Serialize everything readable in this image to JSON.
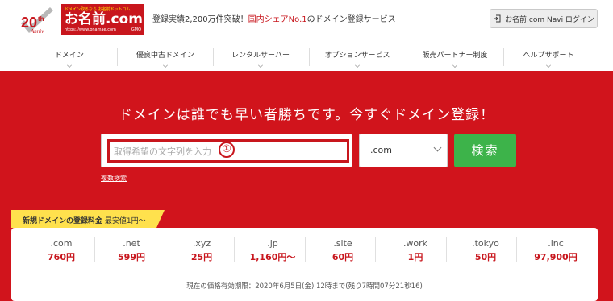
{
  "header": {
    "anniversary_number": "20",
    "anniversary_suffix": "th",
    "anniversary_text": "Anniv.",
    "logo_tagline": "ドメイン取るなら お名前ドットコム",
    "logo_text": "お名前.com",
    "logo_url": "https://www.onamae.com",
    "logo_brand": "GMO",
    "tagline_prefix": "登録実績2,200万件突破！",
    "tagline_highlight": "国内シェアNo.1",
    "tagline_suffix": "のドメイン登録サービス",
    "login_label": "お名前.com Navi ログイン",
    "colors": {
      "brand_red": "#c8161d"
    }
  },
  "nav": {
    "items": [
      {
        "label": "ドメイン"
      },
      {
        "label": "優良中古ドメイン"
      },
      {
        "label": "レンタルサーバー"
      },
      {
        "label": "オプションサービス"
      },
      {
        "label": "販売パートナー制度"
      },
      {
        "label": "ヘルプサポート"
      }
    ]
  },
  "hero": {
    "title": "ドメインは誰でも早い者勝ちです。今すぐドメイン登録！",
    "search_placeholder": "取得希望の文字列を入力",
    "annotation_marker": "①",
    "tld_selected": ".com",
    "search_button": "検索",
    "multi_search_link": "複数検索",
    "colors": {
      "background": "#d1141c",
      "button": "#3db34a"
    }
  },
  "pricing": {
    "ribbon_title": "新規ドメインの登録料金",
    "ribbon_sub": "最安値1円〜",
    "items": [
      {
        "tld": ".com",
        "price": "760円"
      },
      {
        "tld": ".net",
        "price": "599円"
      },
      {
        "tld": ".xyz",
        "price": "25円"
      },
      {
        "tld": ".jp",
        "price": "1,160円〜"
      },
      {
        "tld": ".site",
        "price": "60円"
      },
      {
        "tld": ".work",
        "price": "1円"
      },
      {
        "tld": ".tokyo",
        "price": "50円"
      },
      {
        "tld": ".inc",
        "price": "97,900円"
      }
    ],
    "validity": "現在の価格有効期限：2020年6月5日(金) 12時まで(残り7時間07分21秒16)"
  }
}
